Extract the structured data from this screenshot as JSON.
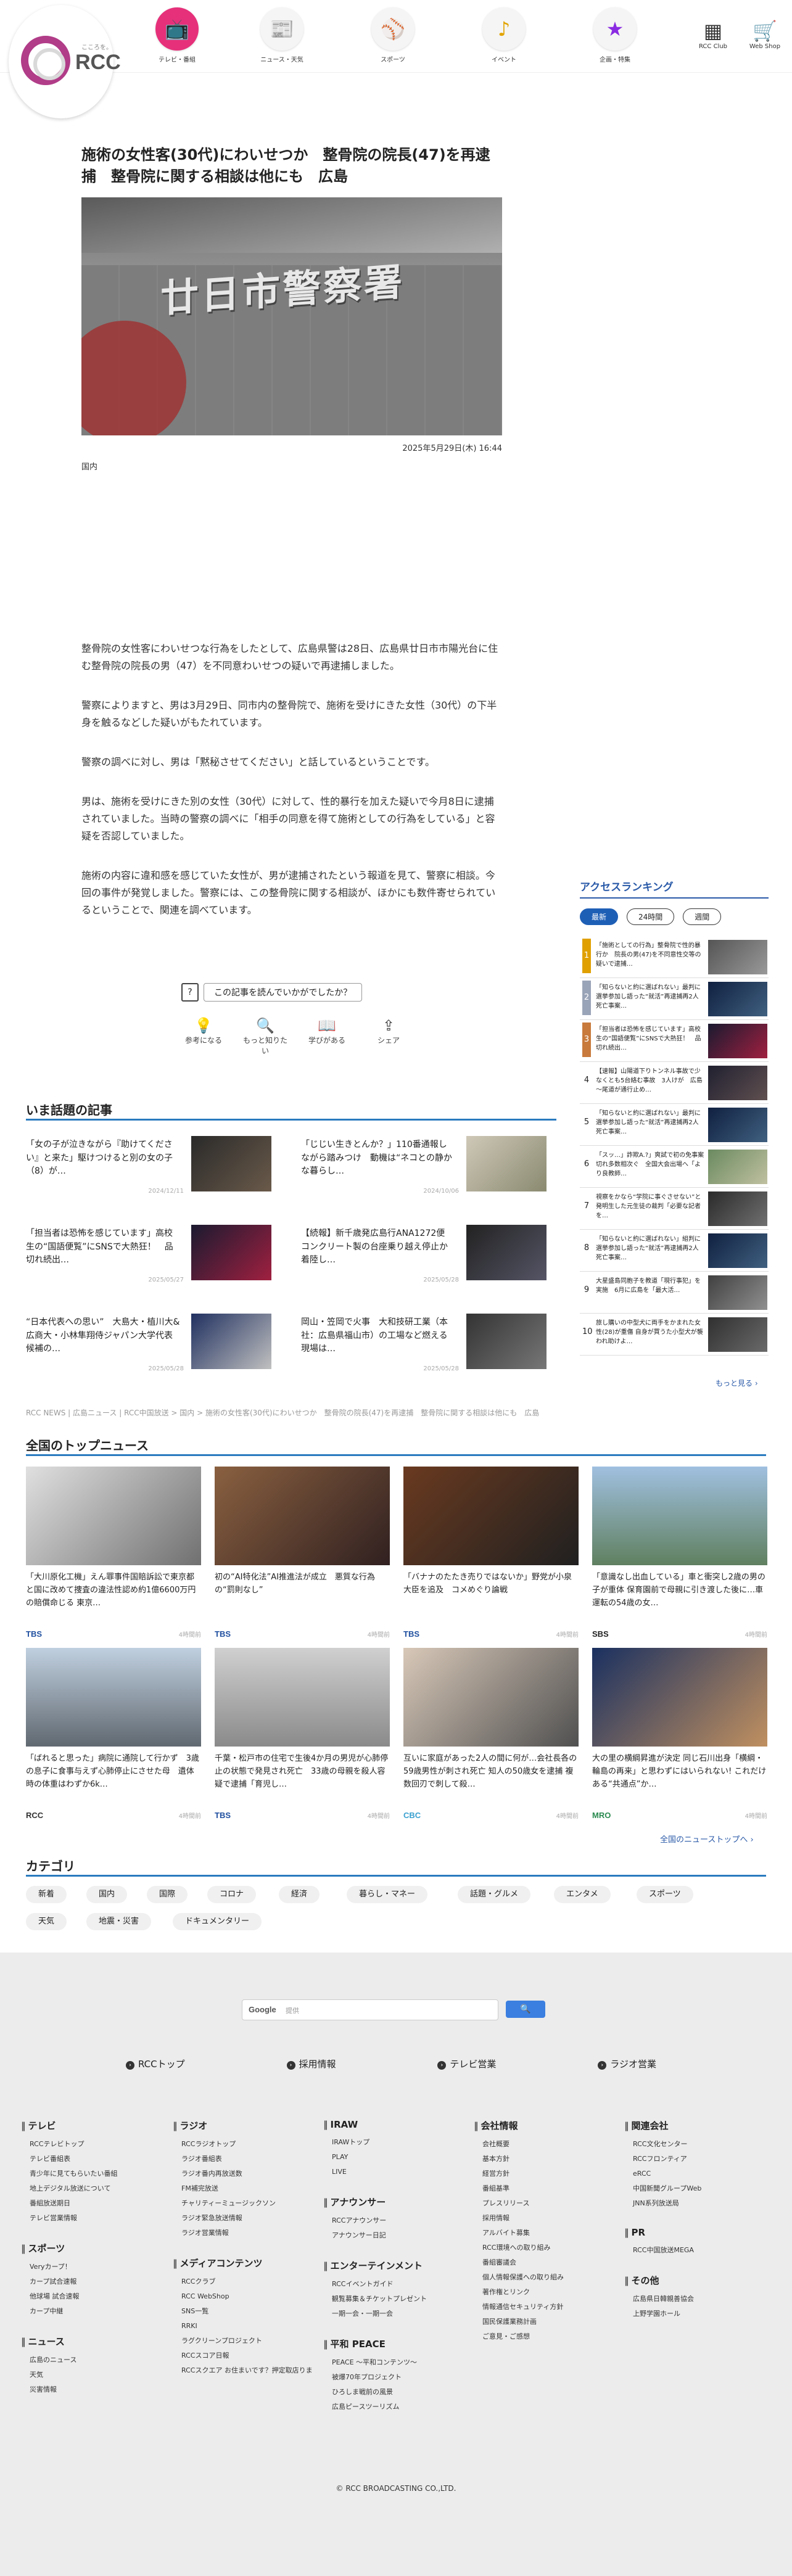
{
  "header": {
    "logo_text": "RCC",
    "logo_sub": "こころを。",
    "nav": [
      {
        "label": "テレビ・番組",
        "icon": "tv-icon",
        "glyph": "📺"
      },
      {
        "label": "ニュース・天気",
        "icon": "news-icon",
        "glyph": "📰"
      },
      {
        "label": "スポーツ",
        "icon": "carp-logo-icon",
        "glyph": "⚾"
      },
      {
        "label": "イベント",
        "icon": "music-note-icon",
        "glyph": "♪"
      },
      {
        "label": "企画・特集",
        "icon": "star-icon",
        "glyph": "★"
      }
    ],
    "club_label": "RCC Club",
    "shop_label": "Web Shop"
  },
  "article": {
    "title": "施術の女性客(30代)にわいせつか　整骨院の院長(47)を再逮捕　整骨院に関する相談は他にも　広島",
    "photo_sign": "廿日市警察署",
    "date": "2025年5月29日(木) 16:44",
    "category": "国内",
    "paragraphs": [
      "整骨院の女性客にわいせつな行為をしたとして、広島県警は28日、広島県廿日市市陽光台に住む整骨院の院長の男（47）を不同意わいせつの疑いで再逮捕しました。",
      "警察によりますと、男は3月29日、同市内の整骨院で、施術を受けにきた女性（30代）の下半身を触るなどした疑いがもたれています。",
      "警察の調べに対し、男は「黙秘させてください」と話しているということです。",
      "男は、施術を受けにきた別の女性（30代）に対して、性的暴行を加えた疑いで今月8日に逮捕されていました。当時の警察の調べに「相手の同意を得て施術としての行為をしている」と容疑を否認していました。",
      "施術の内容に違和感を感じていた女性が、男が逮捕されたという報道を見て、警察に相談。今回の事件が発覚しました。警察には、この整骨院に関する相談が、ほかにも数件寄せられているということで、関連を調べています。"
    ],
    "question": "この記事を読んでいかがでしたか？",
    "reactions": [
      {
        "label": "参考になる",
        "glyph": "💡",
        "icon": "lightbulb-icon"
      },
      {
        "label": "もっと知りたい",
        "glyph": "🔍",
        "icon": "magnifier-icon"
      },
      {
        "label": "学びがある",
        "glyph": "📖",
        "icon": "book-icon"
      },
      {
        "label": "シェア",
        "glyph": "⇪",
        "icon": "share-icon"
      }
    ]
  },
  "hot": {
    "title": "いま話題の記事",
    "items": [
      {
        "title": "「女の子が泣きながら『助けてください』と来た」駆けつけると別の女の子（8）が…",
        "date": "2024/12/11"
      },
      {
        "title": "「じじい生きとんか？」110番通報しながら踏みつけ　動機は“ネコとの静かな暮らし…",
        "date": "2024/10/06"
      },
      {
        "title": "「担当者は恐怖を感じています」高校生の“国語便覧”にSNSで大熱狂！　品切れ続出…",
        "date": "2025/05/27"
      },
      {
        "title": "【続報】新千歳発広島行ANA1272便　コンクリート製の台座乗り越え停止か　着陸し…",
        "date": "2025/05/28"
      },
      {
        "title": "“日本代表への思い”　大島大・植川大&広商大・小林隼翔侍ジャパン大学代表候補の…",
        "date": "2025/05/28"
      },
      {
        "title": "岡山・笠岡で火事　大和技研工業（本社：広島県福山市）の工場など燃える　現場は…",
        "date": "2025/05/28"
      }
    ]
  },
  "breadcrumb": "RCC NEWS | 広島ニュース | RCC中国放送 > 国内 > 施術の女性客(30代)にわいせつか　整骨院の院長(47)を再逮捕　整骨院に関する相談は他にも　広島",
  "ranking": {
    "title": "アクセスランキング",
    "tabs": [
      "最新",
      "24時間",
      "週間"
    ],
    "items": [
      {
        "rank": "1",
        "title": "「施術としての行為」整骨院で性的暴行か　院長の男(47)を不同意性交等の疑いで逮捕…"
      },
      {
        "rank": "2",
        "title": "「知らないと約に選ばれない」最判に選挙参加し語った“就活”再逮捕再2人死亡事案…"
      },
      {
        "rank": "3",
        "title": "「担当者は恐怖を感じています」高校生の“国語便覧”にSNSで大熱狂！　品切れ続出…"
      },
      {
        "rank": "4",
        "title": "【速報】山陽道下りトンネル事故で少なくとも5台絡む事故　3人けが　広島～尾道が通行止め…"
      },
      {
        "rank": "5",
        "title": "「知らないと約に選ばれない」最判に選挙参加し語った“就活”再逮捕再2人死亡事案…"
      },
      {
        "rank": "6",
        "title": "「スッ…」詐欺A.?」爽試で初の免事案切れ多数相次ぐ　全国大会出場へ「より良教師…"
      },
      {
        "rank": "7",
        "title": "視察をかなら“学院に事ぐさせない”と発明生した元生徒の裁判「必要な記者を…"
      },
      {
        "rank": "8",
        "title": "「知らないと約に選ばれない」組判に選挙参加し語った“就活”再逮捕再2人死亡事案…"
      },
      {
        "rank": "9",
        "title": "大星盛島同胞子を教道「現行事犯」を実施　6月に広島を「最大活…"
      },
      {
        "rank": "10",
        "title": "旅し購いの中型犬に両手をかまれた女性(28)が重傷 自身が買うた小型犬が襲われ助けよ…"
      }
    ],
    "more": "もっと見る ›"
  },
  "topnews": {
    "title": "全国のトップニュース",
    "items": [
      {
        "title": "「大川原化工機」えん罪事件国賠訴訟で東京都と国に改めて捜査の違法性認め約1億6600万円の賠償命じる 東京…",
        "source": "TBS",
        "time": "4時間前"
      },
      {
        "title": "初の“AI特化法”AI推進法が成立　悪質な行為の“罰則なし”",
        "source": "TBS",
        "time": "4時間前"
      },
      {
        "title": "「バナナのたたき売りではないか」野党が小泉大臣を追及　コメめぐり論戦",
        "source": "TBS",
        "time": "4時間前"
      },
      {
        "title": "「意識なし出血している」車と衝突し2歳の男の子が重体 保育園前で母親に引き渡した後に…車運転の54歳の女…",
        "source": "SBS",
        "time": "4時間前"
      },
      {
        "title": "「ばれると思った」病院に通院して行かず　3歳の息子に食事与えず心肺停止にさせた母　遺体時の体重はわずか6k…",
        "source": "RCC",
        "time": "4時間前"
      },
      {
        "title": "千葉・松戸市の住宅で生後4か月の男児が心肺停止の状態で発見され死亡　33歳の母親を殺人容疑で逮捕「育児し…",
        "source": "TBS",
        "time": "4時間前"
      },
      {
        "title": "互いに家庭があった2人の間に何が…会社長各の59歳男性が刺され死亡 知人の50歳女を逮捕 複数回刃で刺して殺…",
        "source": "CBC",
        "time": "4時間前"
      },
      {
        "title": "大の里の横綱昇進が決定 同じ石川出身「横綱・輪島の再来」と思わずにはいられない! これだけある“共通点”か…",
        "source": "MRO",
        "time": "4時間前"
      }
    ],
    "more": "全国のニューストップへ ›"
  },
  "categories": {
    "title": "カテゴリ",
    "items": [
      "新着",
      "国内",
      "国際",
      "コロナ",
      "経済",
      "暮らし・マネー",
      "話題・グルメ",
      "エンタメ",
      "スポーツ",
      "天気",
      "地震・災害",
      "ドキュメンタリー"
    ]
  },
  "footer": {
    "search_logo": "Google",
    "search_placeholder": "提供",
    "search_button": "🔍",
    "links": [
      "RCCトップ",
      "採用情報",
      "テレビ営業",
      "ラジオ営業"
    ],
    "columns": [
      {
        "groups": [
          {
            "h": "テレビ",
            "items": [
              "RCCテレビトップ",
              "テレビ番組表",
              "青少年に見てもらいたい番組",
              "地上デジタル放送について",
              "番組放送期日",
              "テレビ営業情報"
            ]
          },
          {
            "h": "スポーツ",
            "items": [
              "Veryカープ！",
              "カープ試合速報",
              "他球場 試合速報",
              "カープ中継"
            ]
          },
          {
            "h": "ニュース",
            "items": [
              "広島のニュース",
              "天気",
              "災害情報"
            ]
          }
        ]
      },
      {
        "groups": [
          {
            "h": "ラジオ",
            "items": [
              "RCCラジオトップ",
              "ラジオ番組表",
              "ラジオ番内再放送数",
              "FM補完放送",
              "チャリティーミュージックソン",
              "ラジオ緊急放送情報",
              "ラジオ営業情報"
            ]
          },
          {
            "h": "メディアコンテンツ",
            "items": [
              "RCCクラブ",
              "RCC WebShop",
              "SNS一覧",
              "RRKI",
              "ラグクリーンプロジェクト",
              "RCCスコア日報",
              "RCCスクエア お住まいです？押定取店りま"
            ]
          }
        ]
      },
      {
        "groups": [
          {
            "h": "IRAW",
            "items": [
              "IRAWトップ",
              "PLAY",
              "LIVE"
            ]
          },
          {
            "h": "アナウンサー",
            "items": [
              "RCCアナウンサー",
              "アナウンサー日記"
            ]
          },
          {
            "h": "エンターテインメント",
            "items": [
              "RCCイベントガイド",
              "観覧募集＆チケットプレゼント",
              "一期一会・一期一会"
            ]
          },
          {
            "h": "平和 PEACE",
            "items": [
              "PEACE 〜平和コンテンツ〜",
              "被爆70年プロジェクト",
              "ひろしま戦前の風景",
              "広島ピースツーリズム"
            ]
          }
        ]
      },
      {
        "groups": [
          {
            "h": "会社情報",
            "items": [
              "会社概要",
              "基本方針",
              "経営方針",
              "番組基準",
              "プレスリリース",
              "採用情報",
              "アルバイト募集",
              "RCC環境への取り組み",
              "番組審議会",
              "個人情報保護への取り組み",
              "著作権とリンク",
              "情報通信セキュリティ方針",
              "国民保護業務計画",
              "ご意見・ご感想"
            ]
          }
        ]
      },
      {
        "groups": [
          {
            "h": "関連会社",
            "items": [
              "RCC文化センター",
              "RCCフロンティア",
              "eRCC",
              "中国新聞グループWeb",
              "JNN系列放送局"
            ]
          },
          {
            "h": "PR",
            "items": [
              "RCC中国放送MEGA"
            ]
          },
          {
            "h": "その他",
            "items": [
              "広島県日韓親善協会",
              "上野学園ホール"
            ]
          }
        ]
      }
    ],
    "copyright": "© RCC BROADCASTING CO.,LTD."
  },
  "colors": {
    "accent": "#2a7bbf",
    "brand": "#b13c88",
    "tv_pink": "#e6307a",
    "rank_blue": "#1e5fb6"
  }
}
